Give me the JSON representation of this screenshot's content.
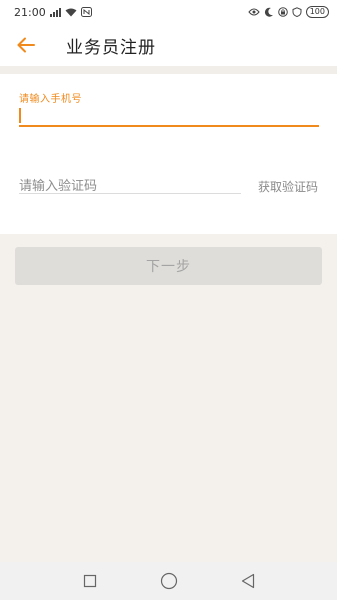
{
  "status_bar": {
    "time": "21:00",
    "left_indicators": [
      "signal-icon",
      "wifi-icon",
      "nfc-icon"
    ],
    "right_indicators": [
      "eye-comfort-icon",
      "moon-icon",
      "lock-icon",
      "alarm-icon"
    ],
    "battery": "100"
  },
  "app_bar": {
    "title": "业务员注册",
    "accent_color": "#f08a1c"
  },
  "form": {
    "phone": {
      "label": "请输入手机号",
      "value": ""
    },
    "code": {
      "placeholder": "请输入验证码",
      "value": "",
      "get_code_label": "获取验证码"
    }
  },
  "actions": {
    "next_label": "下一步"
  },
  "nav_bar": {
    "buttons": [
      "recent-apps-icon",
      "home-icon",
      "back-triangle-icon"
    ]
  }
}
